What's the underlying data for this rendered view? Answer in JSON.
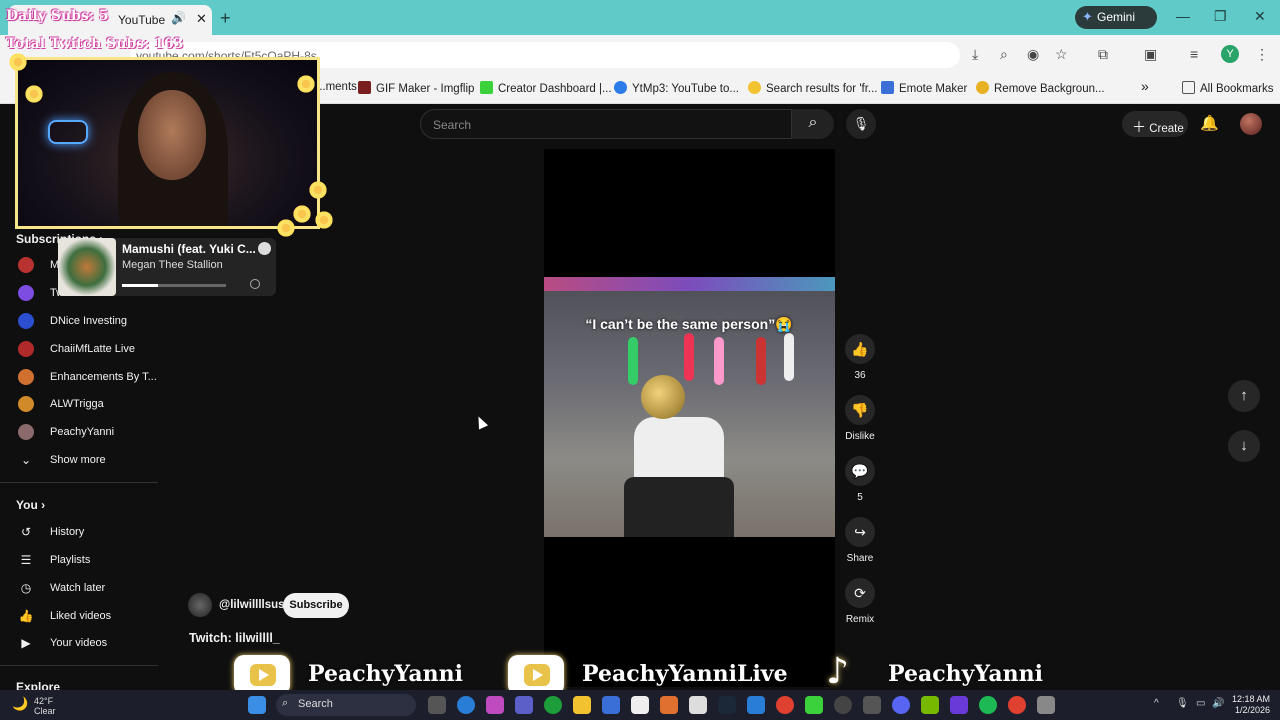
{
  "browser": {
    "tab_title": "YouTube",
    "url": "youtube.com/shorts/Ft5cQaPH-8s",
    "gemini_label": "Gemini",
    "profile_initial": "Y"
  },
  "bookmarks": {
    "items": [
      {
        "label": "...ments",
        "color": "#8a8a8a"
      },
      {
        "label": "GIF Maker - Imgflip",
        "color": "#7a1f1f"
      },
      {
        "label": "Creator Dashboard |...",
        "color": "#3ad13a"
      },
      {
        "label": "YtMp3: YouTube to...",
        "color": "#2d7be8"
      },
      {
        "label": "Search results for 'fr...",
        "color": "#f2c230"
      },
      {
        "label": "Emote Maker",
        "color": "#3a6fd8"
      },
      {
        "label": "Remove Backgroun...",
        "color": "#e8b023"
      }
    ],
    "more": "»",
    "all_bookmarks": "All Bookmarks"
  },
  "youtube": {
    "search_placeholder": "Search",
    "create_label": "Create"
  },
  "overlay": {
    "daily_subs": "Daily Subs: 5",
    "total_subs": "Total Twitch Subs: 163"
  },
  "now_playing": {
    "title": "Mamushi (feat. Yuki C...",
    "artist": "Megan Thee Stallion",
    "progress": 0.35
  },
  "sidebar": {
    "subscriptions_label": "Subscriptions",
    "subscriptions": [
      {
        "label": "M...",
        "color": "#b83232"
      },
      {
        "label": "Tw...",
        "color": "#7d4ce0"
      },
      {
        "label": "DNice Investing",
        "color": "#2b4fd0"
      },
      {
        "label": "ChaiiMfLatte Live",
        "color": "#b02a2a"
      },
      {
        "label": "Enhancements By T...",
        "color": "#d07030"
      },
      {
        "label": "ALWTrigga",
        "color": "#d08a2a"
      },
      {
        "label": "PeachyYanni",
        "color": "#8a6a6a"
      }
    ],
    "show_more": "Show more",
    "you_label": "You",
    "you_items": [
      {
        "label": "History",
        "icon": "history-icon"
      },
      {
        "label": "Playlists",
        "icon": "playlists-icon"
      },
      {
        "label": "Watch later",
        "icon": "watch-later-icon"
      },
      {
        "label": "Liked videos",
        "icon": "liked-videos-icon"
      },
      {
        "label": "Your videos",
        "icon": "your-videos-icon"
      }
    ],
    "explore_label": "Explore"
  },
  "short": {
    "caption": "“I can’t be the same person”😭",
    "likes": "36",
    "dislike_label": "Dislike",
    "comments": "5",
    "share_label": "Share",
    "remix_label": "Remix",
    "channel_handle": "@lilwillllsus",
    "subscribe_label": "Subscribe",
    "description": "Twitch: lilwillll_"
  },
  "socials": {
    "youtube1": "PeachyYanni",
    "youtube2": "PeachyYanniLive",
    "tiktok": "PeachyYanni"
  },
  "taskbar": {
    "temp": "42°F",
    "condition": "Clear",
    "search_label": "Search",
    "time": "12:18 AM",
    "date": "1/2/2026"
  }
}
